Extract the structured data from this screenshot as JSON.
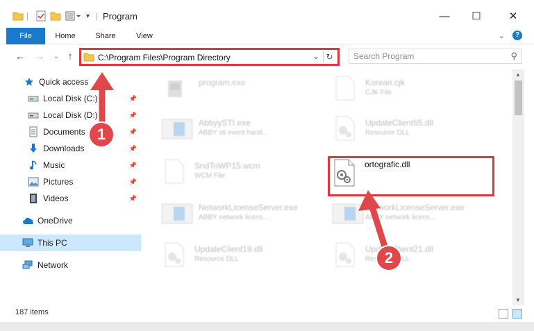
{
  "window": {
    "title": "Program",
    "minimize": "—",
    "maximize": "☐",
    "close": "✕"
  },
  "ribbon": {
    "tabs": [
      "File",
      "Home",
      "Share",
      "View"
    ],
    "expand": "⌄",
    "help": "?"
  },
  "nav": {
    "back": "←",
    "forward": "→",
    "recent": "⌄",
    "up": "↑"
  },
  "address": {
    "path": "C:\\Program Files\\Program Directory",
    "refresh": "↻"
  },
  "search": {
    "placeholder": "Search Program"
  },
  "sidebar": {
    "items": [
      {
        "label": "Quick access",
        "icon": "star-icon",
        "pinned": false
      },
      {
        "label": "Local Disk (C:)",
        "icon": "drive-icon",
        "pinned": true
      },
      {
        "label": "Local Disk (D:)",
        "icon": "drive-icon",
        "pinned": true
      },
      {
        "label": "Documents",
        "icon": "documents-icon",
        "pinned": true
      },
      {
        "label": "Downloads",
        "icon": "download-icon",
        "pinned": true
      },
      {
        "label": "Music",
        "icon": "music-icon",
        "pinned": true
      },
      {
        "label": "Pictures",
        "icon": "pictures-icon",
        "pinned": true
      },
      {
        "label": "Videos",
        "icon": "video-icon",
        "pinned": true
      },
      {
        "label": "OneDrive",
        "icon": "cloud-icon",
        "pinned": false
      },
      {
        "label": "This PC",
        "icon": "computer-icon",
        "pinned": false,
        "selected": true
      },
      {
        "label": "Network",
        "icon": "network-icon",
        "pinned": false
      }
    ]
  },
  "files": [
    {
      "name": "program.exe",
      "desc": "",
      "type": "exe"
    },
    {
      "name": "Korean.cjk",
      "desc": "CJK File",
      "type": "blank"
    },
    {
      "name": "AbbyySTI.exe",
      "desc": "ABBY sti event hand...",
      "type": "app"
    },
    {
      "name": "UpdateClient65.dll",
      "desc": "Resource DLL",
      "type": "dll"
    },
    {
      "name": "SndToWP15.wcm",
      "desc": "WCM File",
      "type": "blank"
    },
    {
      "name": "ortografic.dll",
      "desc": "",
      "type": "dll-sharp"
    },
    {
      "name": "NetworkLicenseServer.exe",
      "desc": "ABBY network licens...",
      "type": "app"
    },
    {
      "name": "NetworkLicenseServer.exe",
      "desc": "ABBY network licens...",
      "type": "app"
    },
    {
      "name": "UpdateClient19.dll",
      "desc": "Resource DLL",
      "type": "dll"
    },
    {
      "name": "UpdateClient21.dll",
      "desc": "Resource DLL",
      "type": "dll"
    }
  ],
  "status": {
    "count": "187 items"
  },
  "callouts": [
    "1",
    "2"
  ],
  "colors": {
    "accent": "#1979ca",
    "highlight": "#e3353a",
    "callout": "#e0474a",
    "selected": "#cce8ff"
  }
}
